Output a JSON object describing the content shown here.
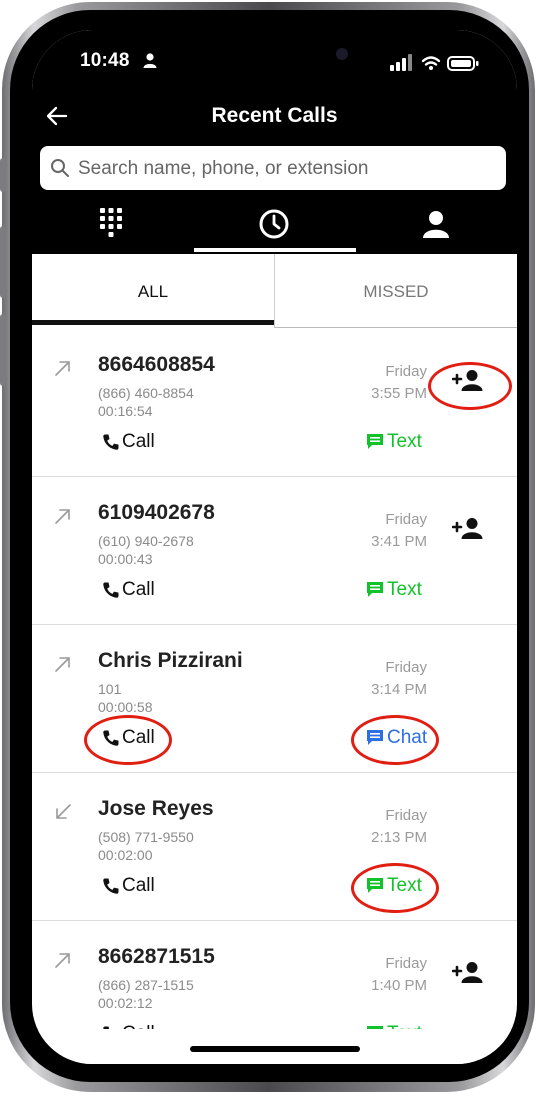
{
  "status_bar": {
    "time": "10:48"
  },
  "header": {
    "title": "Recent Calls"
  },
  "search": {
    "placeholder": "Search name, phone, or extension"
  },
  "nav_tabs": [
    {
      "icon": "dialpad-icon"
    },
    {
      "icon": "clock-icon",
      "active": true
    },
    {
      "icon": "contacts-icon"
    }
  ],
  "sub_tabs": {
    "all": "ALL",
    "missed": "MISSED",
    "active": "ALL"
  },
  "calls": [
    {
      "name": "8664608854",
      "number": "(866) 460-8854",
      "duration": "00:16:54",
      "day": "Friday",
      "time": "3:55 PM",
      "direction": "outgoing",
      "call_label": "Call",
      "message_label": "Text",
      "message_type": "text",
      "add_contact": true
    },
    {
      "name": "6109402678",
      "number": "(610) 940-2678",
      "duration": "00:00:43",
      "day": "Friday",
      "time": "3:41 PM",
      "direction": "outgoing",
      "call_label": "Call",
      "message_label": "Text",
      "message_type": "text",
      "add_contact": true
    },
    {
      "name": "Chris Pizzirani",
      "number": "101",
      "duration": "00:00:58",
      "day": "Friday",
      "time": "3:14 PM",
      "direction": "outgoing",
      "call_label": "Call",
      "message_label": "Chat",
      "message_type": "chat",
      "add_contact": false
    },
    {
      "name": "Jose Reyes",
      "number": "(508) 771-9550",
      "duration": "00:02:00",
      "day": "Friday",
      "time": "2:13 PM",
      "direction": "incoming",
      "call_label": "Call",
      "message_label": "Text",
      "message_type": "text",
      "add_contact": false
    },
    {
      "name": "8662871515",
      "number": "(866) 287-1515",
      "duration": "00:02:12",
      "day": "Friday",
      "time": "1:40 PM",
      "direction": "outgoing",
      "call_label": "Call",
      "message_label": "Text",
      "message_type": "text",
      "add_contact": true
    }
  ],
  "colors": {
    "text_green": "#12c22a",
    "chat_blue": "#2b6fe0",
    "annotation_red": "#e01e12"
  }
}
